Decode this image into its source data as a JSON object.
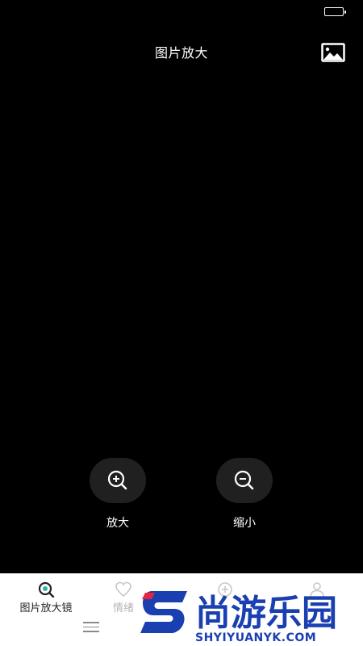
{
  "header": {
    "title": "图片放大",
    "image_button_icon": "image-icon"
  },
  "controls": {
    "zoom_in": {
      "label": "放大",
      "icon": "zoom-in-icon"
    },
    "zoom_out": {
      "label": "缩小",
      "icon": "zoom-out-icon"
    }
  },
  "bottom_nav": {
    "items": [
      {
        "label": "图片放大镜",
        "icon": "magnifier-icon",
        "active": true
      },
      {
        "label": "情绪",
        "icon": "heart-icon",
        "active": false
      },
      {
        "label": "",
        "icon": "plus-circle-icon",
        "active": false
      },
      {
        "label": "",
        "icon": "person-icon",
        "active": false
      }
    ],
    "menu_icon": "menu-icon"
  },
  "watermark": {
    "brand": "尚游乐园",
    "url": "SHYIYUANYK.COM",
    "colors": {
      "brand": "#1a3fb0",
      "accent": "#e8243c"
    }
  },
  "colors": {
    "background": "#000000",
    "button_bg": "#202020",
    "nav_bg": "#ffffff",
    "active_accent": "#2bb4a0"
  }
}
